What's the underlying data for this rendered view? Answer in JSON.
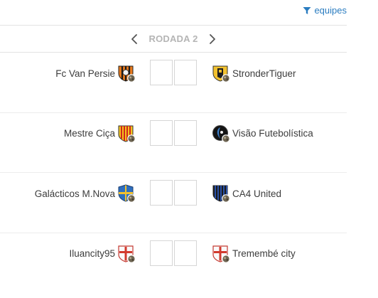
{
  "header": {
    "filter_label": "equipes",
    "filter_icon": "filter-icon"
  },
  "round": {
    "label": "RODADA 2",
    "prev_icon": "chevron-left-icon",
    "next_icon": "chevron-right-icon"
  },
  "matches": [
    {
      "home": {
        "name": "Fc Van Persie",
        "crest": "orange-black-striped-crest"
      },
      "away": {
        "name": "StronderTiguer",
        "crest": "yellow-black-shield-crest"
      },
      "home_score": "",
      "away_score": ""
    },
    {
      "home": {
        "name": "Mestre Ciça",
        "crest": "yellow-red-striped-crest"
      },
      "away": {
        "name": "Visão Futebolística",
        "crest": "black-round-crest"
      },
      "home_score": "",
      "away_score": ""
    },
    {
      "home": {
        "name": "Galácticos M.Nova",
        "crest": "blue-yellow-shield-crest"
      },
      "away": {
        "name": "CA4 United",
        "crest": "blue-black-striped-crest"
      },
      "home_score": "",
      "away_score": ""
    },
    {
      "home": {
        "name": "Iluancity95",
        "crest": "white-red-cross-crest"
      },
      "away": {
        "name": "Tremembé city",
        "crest": "white-red-cross-crest"
      },
      "home_score": "",
      "away_score": ""
    }
  ],
  "colors": {
    "accent": "#2a7cc0",
    "round_label": "#b5b5b5",
    "divider": "#e3e3e3"
  }
}
